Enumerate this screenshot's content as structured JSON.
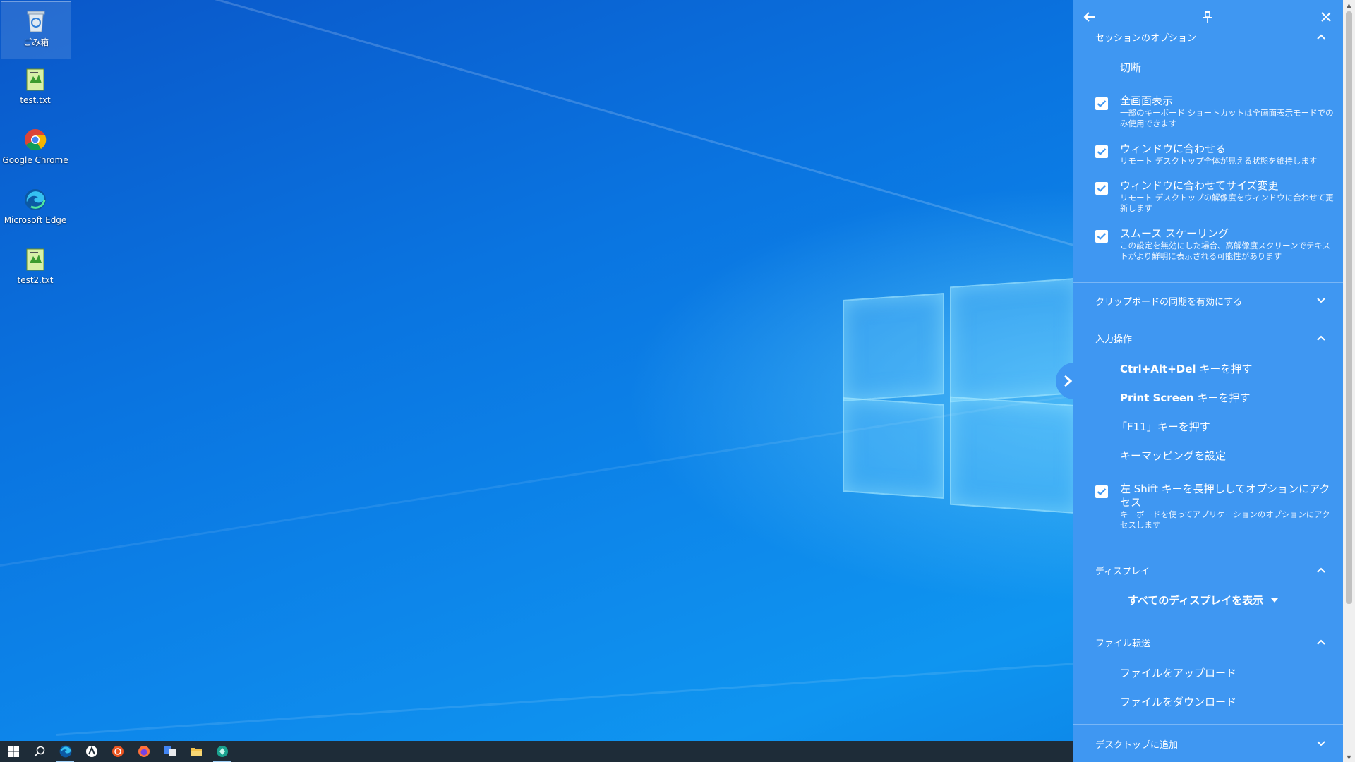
{
  "desktop": {
    "icons": [
      {
        "label": "ごみ箱",
        "icon": "recycle-bin-icon"
      },
      {
        "label": "test.txt",
        "icon": "text-file-icon"
      },
      {
        "label": "Google Chrome",
        "icon": "chrome-icon"
      },
      {
        "label": "Microsoft Edge",
        "icon": "edge-icon"
      },
      {
        "label": "test2.txt",
        "icon": "text-file-icon"
      }
    ]
  },
  "taskbar": {
    "items": [
      "start-icon",
      "search-icon",
      "edge-icon",
      "app-icon",
      "ubuntu-icon",
      "firefox-icon",
      "translate-icon",
      "file-explorer-icon",
      "remote-desktop-icon"
    ]
  },
  "panel": {
    "sections": {
      "session": {
        "title": "セッションのオプション",
        "disconnect": "切断",
        "options": [
          {
            "title": "全画面表示",
            "desc": "一部のキーボード ショートカットは全画面表示モードでのみ使用できます",
            "checked": true
          },
          {
            "title": "ウィンドウに合わせる",
            "desc": "リモート デスクトップ全体が見える状態を維持します",
            "checked": true
          },
          {
            "title": "ウィンドウに合わせてサイズ変更",
            "desc": "リモート デスクトップの解像度をウィンドウに合わせて更新します",
            "checked": true
          },
          {
            "title": "スムース スケーリング",
            "desc": "この設定を無効にした場合、高解像度スクリーンでテキストがより鮮明に表示される可能性があります",
            "checked": true
          }
        ]
      },
      "clipboard": {
        "title": "クリップボードの同期を有効にする"
      },
      "input": {
        "title": "入力操作",
        "ctrl_alt_del_key": "Ctrl+Alt+Del",
        "ctrl_alt_del_suffix": " キーを押す",
        "print_screen_key": "Print Screen",
        "print_screen_suffix": " キーを押す",
        "f11": "「F11」キーを押す",
        "key_mapping": "キーマッピングを設定",
        "shift_option": {
          "title": "左 Shift キーを長押ししてオプションにアクセス",
          "desc": "キーボードを使ってアプリケーションのオプションにアクセスします",
          "checked": true
        }
      },
      "display": {
        "title": "ディスプレイ",
        "selected": "すべてのディスプレイを表示"
      },
      "file_transfer": {
        "title": "ファイル転送",
        "upload": "ファイルをアップロード",
        "download": "ファイルをダウンロード"
      },
      "add_to_desktop": {
        "title": "デスクトップに追加"
      }
    }
  },
  "colors": {
    "panel_bg": "#3f97f2",
    "taskbar_bg": "#1e2c38"
  }
}
